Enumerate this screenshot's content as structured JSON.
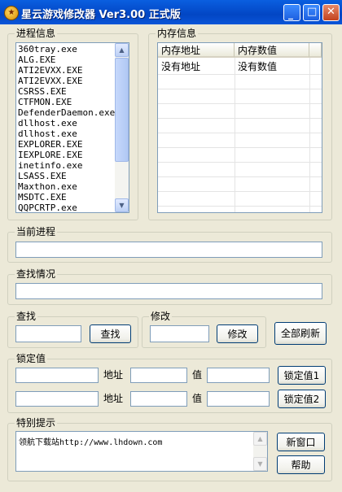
{
  "window": {
    "title": "星云游戏修改器 Ver3.00 正式版",
    "controls": {
      "minimize": "_",
      "maximize": "□",
      "close": "✕"
    }
  },
  "process_group": {
    "legend": "进程信息",
    "items": [
      "360tray.exe",
      "ALG.EXE",
      "ATI2EVXX.EXE",
      "ATI2EVXX.EXE",
      "CSRSS.EXE",
      "CTFMON.EXE",
      "DefenderDaemon.exe",
      "dllhost.exe",
      "dllhost.exe",
      "EXPLORER.EXE",
      "IEXPLORE.EXE",
      "inetinfo.exe",
      "LSASS.EXE",
      "Maxthon.exe",
      "MSDTC.EXE",
      "QQPCRTP.exe"
    ]
  },
  "memory_group": {
    "legend": "内存信息",
    "columns": [
      "内存地址",
      "内存数值"
    ],
    "rows": [
      [
        "没有地址",
        "没有数值"
      ]
    ]
  },
  "current_process": {
    "legend": "当前进程",
    "value": ""
  },
  "search_status": {
    "legend": "查找情况",
    "value": ""
  },
  "search": {
    "legend": "查找",
    "value": "",
    "button": "查找"
  },
  "modify": {
    "legend": "修改",
    "value": "",
    "button": "修改"
  },
  "refresh_all": "全部刷新",
  "lock_group": {
    "legend": "锁定值",
    "address_label": "地址",
    "value_label": "值",
    "rows": [
      {
        "name": "",
        "address": "",
        "value": "",
        "button": "锁定值1"
      },
      {
        "name": "",
        "address": "",
        "value": "",
        "button": "锁定值2"
      }
    ]
  },
  "notes_group": {
    "legend": "特别提示",
    "text": "领航下载站http://www.lhdown.com",
    "new_window": "新窗口",
    "help": "帮助"
  }
}
